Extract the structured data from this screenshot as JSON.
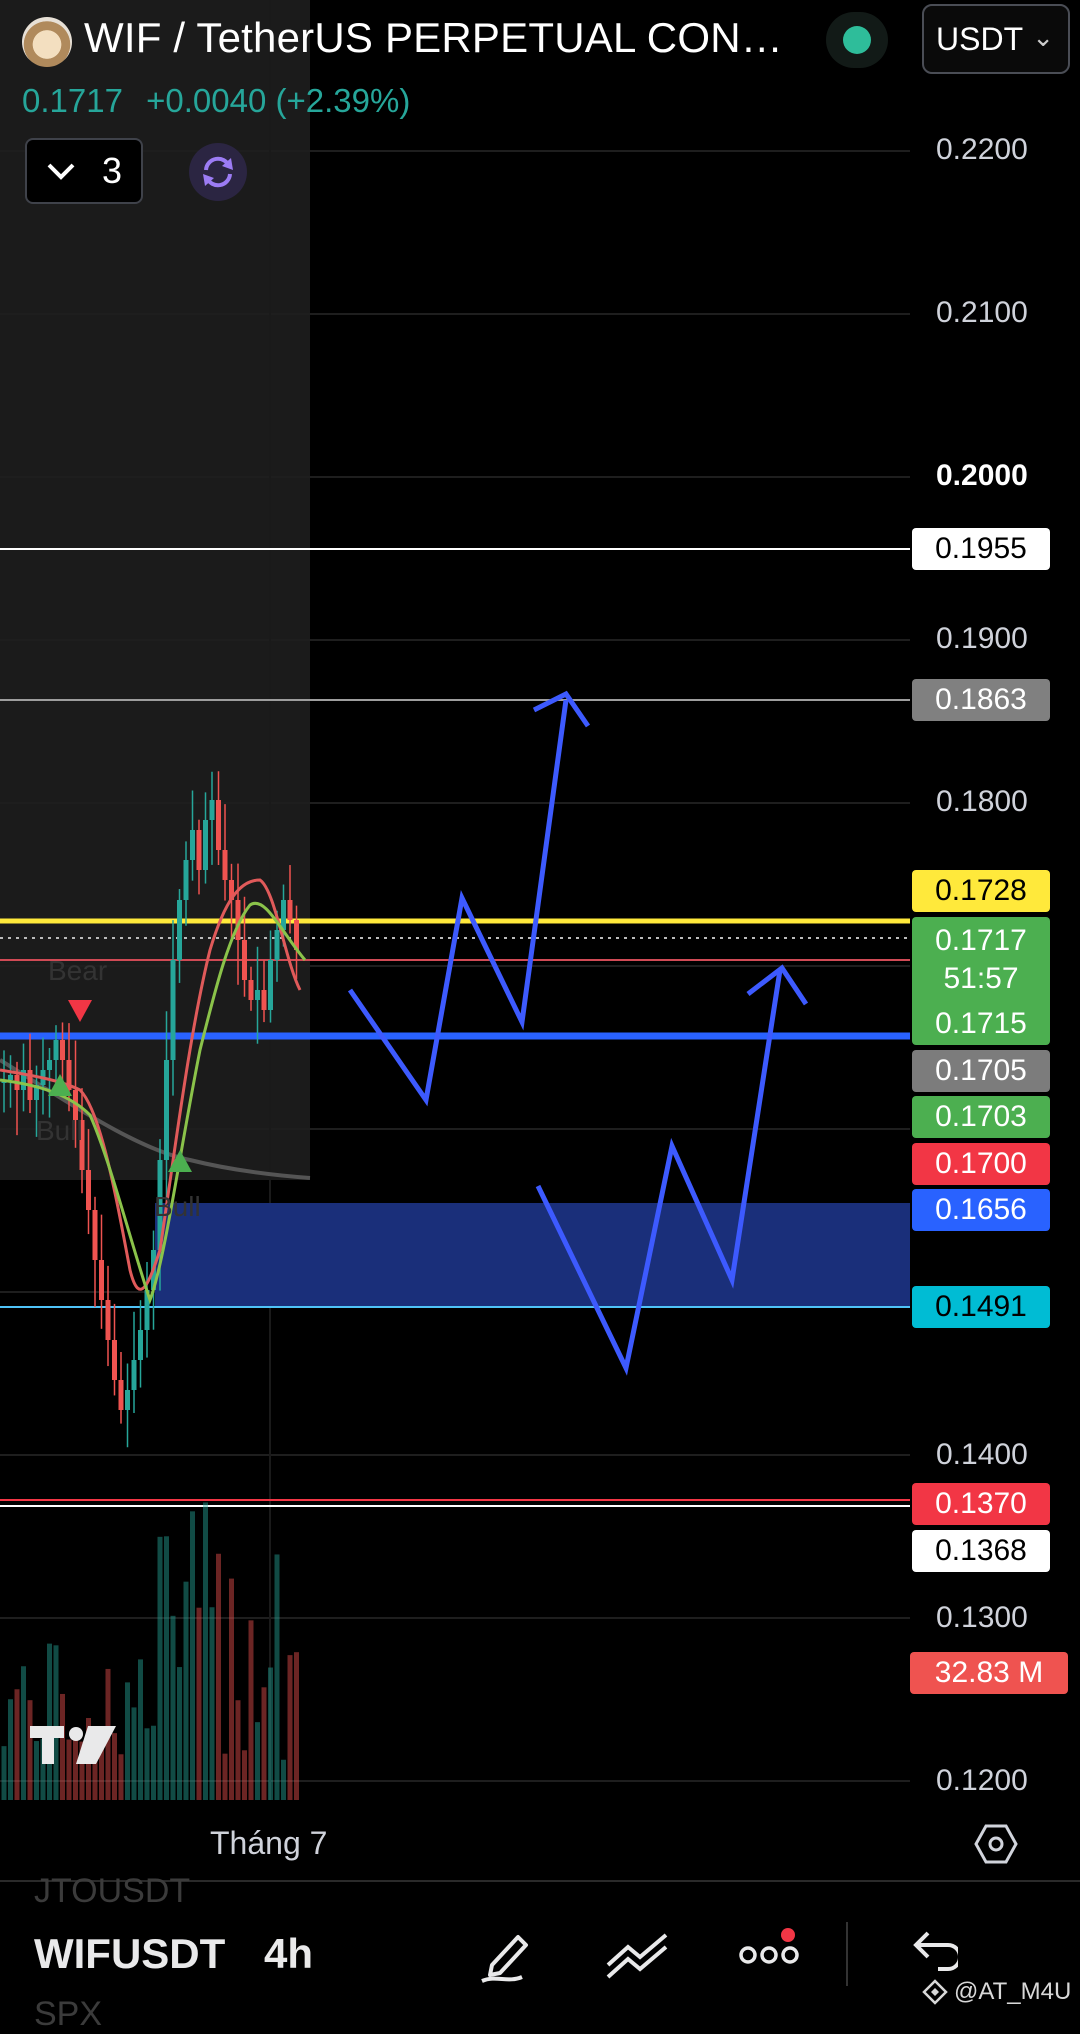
{
  "header": {
    "title": "WIF / TetherUS PERPETUAL CONTRACT",
    "price": "0.1717",
    "change": "+0.0040 (+2.39%)",
    "currency": "USDT",
    "indicator_count": "3"
  },
  "price_axis": {
    "labels": [
      "0.2200",
      "0.2100",
      "0.2000",
      "0.1900",
      "0.1800",
      "0.1400",
      "0.1300",
      "0.1200"
    ],
    "bold_label": "0.2000"
  },
  "price_tags": [
    {
      "label": "0.1955",
      "bg": "#ffffff",
      "fg": "#000000"
    },
    {
      "label": "0.1863",
      "bg": "#808080",
      "fg": "#ffffff"
    },
    {
      "label": "0.1728",
      "bg": "#ffe93b",
      "fg": "#000000"
    },
    {
      "label": "0.1717",
      "countdown": "51:57",
      "bg": "#4caf50",
      "fg": "#ffffff"
    },
    {
      "label": "0.1715",
      "bg": "#4caf50",
      "fg": "#ffffff"
    },
    {
      "label": "0.1705",
      "bg": "#7c7c7c",
      "fg": "#ffffff"
    },
    {
      "label": "0.1703",
      "bg": "#4caf50",
      "fg": "#ffffff"
    },
    {
      "label": "0.1700",
      "bg": "#f23645",
      "fg": "#ffffff"
    },
    {
      "label": "0.1656",
      "bg": "#2962ff",
      "fg": "#ffffff"
    },
    {
      "label": "0.1491",
      "bg": "#00bcd4",
      "fg": "#000000"
    },
    {
      "label": "0.1370",
      "bg": "#f23645",
      "fg": "#ffffff"
    },
    {
      "label": "0.1368",
      "bg": "#ffffff",
      "fg": "#000000"
    },
    {
      "label": "32.83 M",
      "bg": "#ef5350",
      "fg": "#ffffff"
    }
  ],
  "chart_labels": {
    "bear": "Bear",
    "bull1": "Bull",
    "bull2": "Bull"
  },
  "time_axis": {
    "label": "Tháng 7"
  },
  "bottom_bar": {
    "symbol": "WIFUSDT",
    "interval": "4h",
    "ghost_above": "JTOUSDT",
    "ghost_below": "SPX",
    "watermark": "@AT_M4U"
  },
  "colors": {
    "up": "#26a69a",
    "down": "#ef5350",
    "drawing_blue": "#3d5afe",
    "zone_blue": "#1a2f7a"
  },
  "icons": {
    "indicator": "chevron-down-icon",
    "refresh": "refresh-icon",
    "settings": "hexagon-settings-icon",
    "draw": "pencil-icon",
    "trend": "trend-line-icon",
    "more": "more-dots-icon",
    "undo": "undo-icon"
  }
}
